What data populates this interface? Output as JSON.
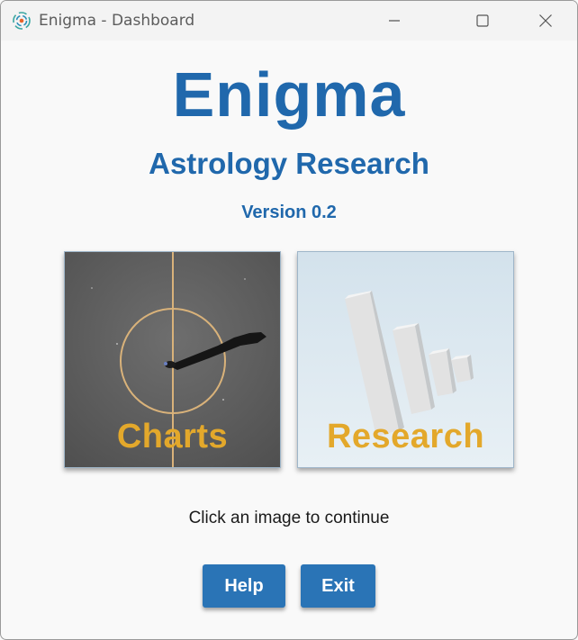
{
  "window": {
    "title": "Enigma - Dashboard"
  },
  "header": {
    "app_name": "Enigma",
    "subtitle": "Astrology Research",
    "version": "Version 0.2"
  },
  "tiles": [
    {
      "label": "Charts"
    },
    {
      "label": "Research"
    }
  ],
  "instruction": "Click an image to continue",
  "buttons": {
    "help": "Help",
    "exit": "Exit"
  },
  "colors": {
    "accent": "#2068ac",
    "button": "#2a74b6",
    "tile_label": "#e3a82b",
    "background": "#f9f9f9"
  }
}
